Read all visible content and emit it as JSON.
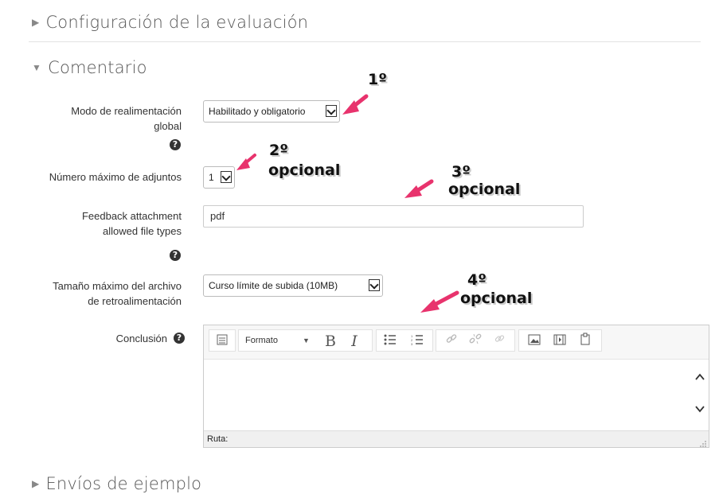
{
  "sections": {
    "grading": "Configuración de la evaluación",
    "feedback": "Comentario",
    "examples": "Envíos de ejemplo"
  },
  "fields": {
    "global_feedback_mode": {
      "label_l1": "Modo de realimentación",
      "label_l2": "global",
      "value": "Habilitado y obligatorio"
    },
    "max_attachments": {
      "label": "Número máximo de adjuntos",
      "value": "1"
    },
    "file_types": {
      "label_l1": "Feedback attachment",
      "label_l2": "allowed file types",
      "value": "pdf"
    },
    "max_file_size": {
      "label_l1": "Tamaño máximo del archivo",
      "label_l2": "de retroalimentación",
      "value": "Curso límite de subida (10MB)"
    },
    "conclusion": {
      "label": "Conclusión"
    }
  },
  "editor": {
    "format_label": "Formato",
    "bold": "B",
    "italic": "I",
    "status": "Ruta:",
    "colors": {
      "toolbar_bg": "#f7f7f7",
      "statusbar_bg": "#f0f0f0"
    }
  },
  "annotations": {
    "a1": {
      "num": "1º",
      "text": ""
    },
    "a2": {
      "num": "2º",
      "text": "opcional"
    },
    "a3": {
      "num": "3º",
      "text": "opcional"
    },
    "a4": {
      "num": "4º",
      "text": "opcional"
    },
    "arrow_color": "#e8336d"
  },
  "icons": [
    "help-icon",
    "chevron-right-icon",
    "chevron-down-icon",
    "bullet-list-icon",
    "numbered-list-icon",
    "link-icon",
    "unlink-icon",
    "image-icon",
    "media-icon",
    "manage-files-icon",
    "scroll-up-icon",
    "scroll-down-icon"
  ]
}
